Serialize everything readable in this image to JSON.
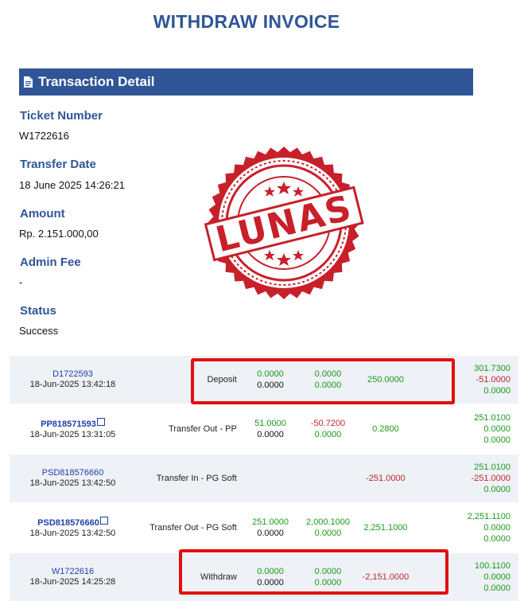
{
  "title": "WITHDRAW INVOICE",
  "section": {
    "icon": "document-icon",
    "label": "Transaction Detail"
  },
  "fields": [
    {
      "label": "Ticket Number",
      "value": "W1722616"
    },
    {
      "label": "Transfer Date",
      "value": "18 June 2025 14:26:21"
    },
    {
      "label": "Amount",
      "value": "Rp. 2.151.000,00"
    },
    {
      "label": "Admin Fee",
      "value": "-"
    },
    {
      "label": "Status",
      "value": "Success"
    }
  ],
  "stamp": {
    "text": "LUNAS",
    "color": "#c8202a"
  },
  "transactions": [
    {
      "id": "D1722593",
      "id_bold": false,
      "copy": false,
      "time": "18-Jun-2025 13:42:18",
      "desc": "Deposit",
      "c1": [
        {
          "v": "0.0000",
          "c": "g"
        },
        {
          "v": "0.0000",
          "c": "k"
        }
      ],
      "c2": [
        {
          "v": "0.0000",
          "c": "g"
        },
        {
          "v": "0.0000",
          "c": "g"
        }
      ],
      "c3": [
        {
          "v": "250.0000",
          "c": "g"
        }
      ],
      "c4": [
        {
          "v": "301.7300",
          "c": "g"
        },
        {
          "v": "-51.0000",
          "c": "r"
        },
        {
          "v": "0.0000",
          "c": "g"
        }
      ]
    },
    {
      "id": "PP818571593",
      "id_bold": true,
      "copy": true,
      "time": "18-Jun-2025 13:31:05",
      "desc": "Transfer Out - PP",
      "c1": [
        {
          "v": "51.0000",
          "c": "g"
        },
        {
          "v": "0.0000",
          "c": "k"
        }
      ],
      "c2": [
        {
          "v": "-50.7200",
          "c": "r"
        },
        {
          "v": "0.0000",
          "c": "g"
        }
      ],
      "c3": [
        {
          "v": "0.2800",
          "c": "g"
        }
      ],
      "c4": [
        {
          "v": "251.0100",
          "c": "g"
        },
        {
          "v": "0.0000",
          "c": "g"
        },
        {
          "v": "0.0000",
          "c": "g"
        }
      ]
    },
    {
      "id": "PSD818576660",
      "id_bold": false,
      "copy": false,
      "time": "18-Jun-2025 13:42:50",
      "desc": "Transfer In - PG Soft",
      "c1": [],
      "c2": [],
      "c3": [
        {
          "v": "-251.0000",
          "c": "r"
        }
      ],
      "c4": [
        {
          "v": "251.0100",
          "c": "g"
        },
        {
          "v": "-251.0000",
          "c": "r"
        },
        {
          "v": "0.0000",
          "c": "g"
        }
      ]
    },
    {
      "id": "PSD818576660",
      "id_bold": true,
      "copy": true,
      "time": "18-Jun-2025 13:42:50",
      "desc": "Transfer Out - PG Soft",
      "c1": [
        {
          "v": "251.0000",
          "c": "g"
        },
        {
          "v": "0.0000",
          "c": "k"
        }
      ],
      "c2": [
        {
          "v": "2,000.1000",
          "c": "g"
        },
        {
          "v": "0.0000",
          "c": "g"
        }
      ],
      "c3": [
        {
          "v": "2,251.1000",
          "c": "g"
        }
      ],
      "c4": [
        {
          "v": "2,251.1100",
          "c": "g"
        },
        {
          "v": "0.0000",
          "c": "g"
        },
        {
          "v": "0.0000",
          "c": "g"
        }
      ]
    },
    {
      "id": "W1722616",
      "id_bold": false,
      "copy": false,
      "time": "18-Jun-2025 14:25:28",
      "desc": "Withdraw",
      "c1": [
        {
          "v": "0.0000",
          "c": "g"
        },
        {
          "v": "0.0000",
          "c": "k"
        }
      ],
      "c2": [
        {
          "v": "0.0000",
          "c": "g"
        },
        {
          "v": "0.0000",
          "c": "g"
        }
      ],
      "c3": [
        {
          "v": "-2,151.0000",
          "c": "r"
        }
      ],
      "c4": [
        {
          "v": "100.1100",
          "c": "g"
        },
        {
          "v": "0.0000",
          "c": "g"
        },
        {
          "v": "0.0000",
          "c": "g"
        }
      ]
    }
  ],
  "colors": {
    "brand": "#2f5597",
    "positive": "#1a9a1a",
    "negative": "#c0262b",
    "highlight": "#e01010"
  }
}
